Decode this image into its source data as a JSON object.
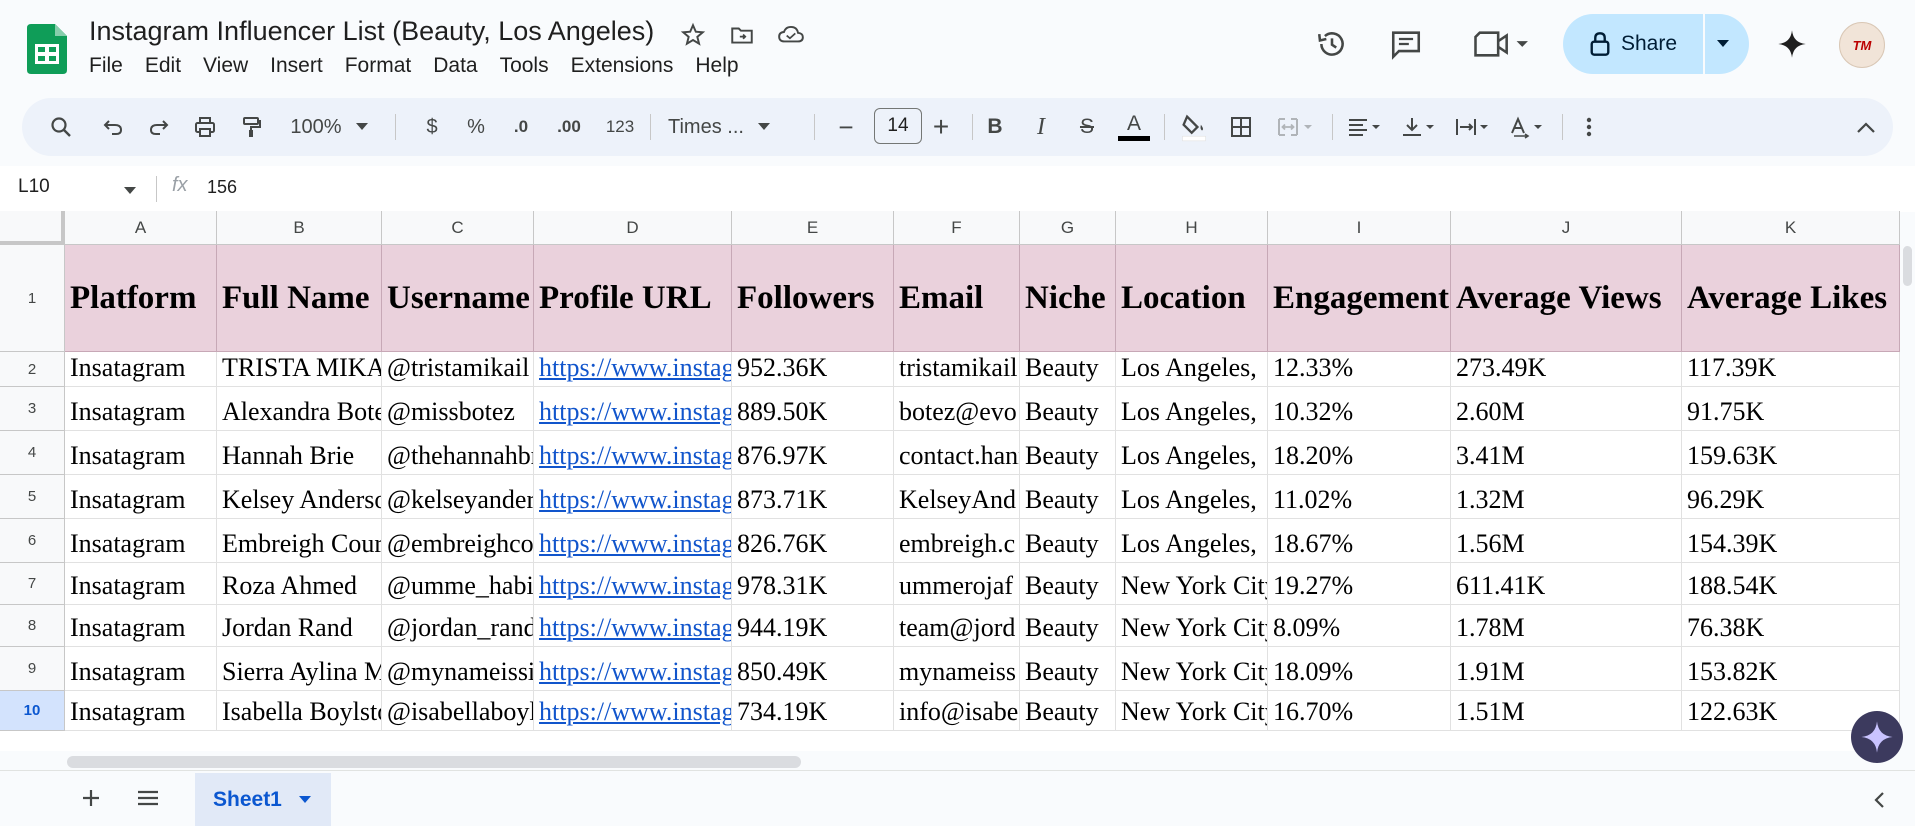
{
  "header": {
    "title": "Instagram Influencer List (Beauty, Los Angeles)",
    "menu": [
      "File",
      "Edit",
      "View",
      "Insert",
      "Format",
      "Data",
      "Tools",
      "Extensions",
      "Help"
    ],
    "share_label": "Share",
    "avatar_text": "TM"
  },
  "toolbar": {
    "zoom": "100%",
    "currency": "$",
    "percent": "%",
    "dec_decrease": ".0",
    "dec_increase": ".00",
    "number_format": "123",
    "font": "Times ...",
    "font_size": "14",
    "minus": "−",
    "plus": "+",
    "bold": "B",
    "italic": "I",
    "strike": "S",
    "text_color": "A"
  },
  "formula_bar": {
    "cell_ref": "L10",
    "fx": "fx",
    "value": "156"
  },
  "columns": [
    "A",
    "B",
    "C",
    "D",
    "E",
    "F",
    "G",
    "H",
    "I",
    "J",
    "K"
  ],
  "rows": [
    "1",
    "2",
    "3",
    "4",
    "5",
    "6",
    "7",
    "8",
    "9",
    "10"
  ],
  "selected_row": "10",
  "table": {
    "headers": [
      "Platform",
      "Full Name",
      "Username",
      "Profile URL",
      "Followers",
      "Email",
      "Niche",
      "Location",
      "Engagement",
      "Average Views",
      "Average Likes"
    ],
    "data": [
      [
        "Insatagram",
        "TRISTA MIKAIL",
        "@tristamikail",
        "https://www.instagram.com",
        "952.36K",
        "tristamikail",
        "Beauty",
        "Los Angeles,",
        "12.33%",
        "273.49K",
        "117.39K"
      ],
      [
        "Insatagram",
        "Alexandra Botez",
        "@missbotez",
        "https://www.instagram.com",
        "889.50K",
        "botez@evo",
        "Beauty",
        "Los Angeles,",
        "10.32%",
        "2.60M",
        "91.75K"
      ],
      [
        "Insatagram",
        "Hannah Brie",
        "@thehannahbrie",
        "https://www.instagram.com",
        "876.97K",
        "contact.hannah",
        "Beauty",
        "Los Angeles,",
        "18.20%",
        "3.41M",
        "159.63K"
      ],
      [
        "Insatagram",
        "Kelsey Anderson",
        "@kelseyanderson",
        "https://www.instagram.com",
        "873.71K",
        "KelseyAnd",
        "Beauty",
        "Los Angeles,",
        "11.02%",
        "1.32M",
        "96.29K"
      ],
      [
        "Insatagram",
        "Embreigh Courtney",
        "@embreighcourtney",
        "https://www.instagram.com",
        "826.76K",
        "embreigh.c",
        "Beauty",
        "Los Angeles,",
        "18.67%",
        "1.56M",
        "154.39K"
      ],
      [
        "Insatagram",
        "Roza Ahmed",
        "@umme_habiba",
        "https://www.instagram.com",
        "978.31K",
        "ummerojaf",
        "Beauty",
        "New York City",
        "19.27%",
        "611.41K",
        "188.54K"
      ],
      [
        "Insatagram",
        "Jordan Rand",
        "@jordan_rand",
        "https://www.instagram.com",
        "944.19K",
        "team@jord",
        "Beauty",
        "New York City",
        "8.09%",
        "1.78M",
        "76.38K"
      ],
      [
        "Insatagram",
        "Sierra Aylina M",
        "@mynameissierra",
        "https://www.instagram.com",
        "850.49K",
        "mynameiss",
        "Beauty",
        "New York City",
        "18.09%",
        "1.91M",
        "153.82K"
      ],
      [
        "Insatagram",
        "Isabella Boylston",
        "@isabellaboylston",
        "https://www.instagram.com",
        "734.19K",
        "info@isabe",
        "Beauty",
        "New York City",
        "16.70%",
        "1.51M",
        "122.63K"
      ]
    ]
  },
  "bottom": {
    "sheet_tab": "Sheet1"
  },
  "colors": {
    "header_fill": "#ead1dc",
    "link": "#1155cc",
    "share_bg": "#c2e7ff",
    "sheets_green": "#0f9d58"
  }
}
